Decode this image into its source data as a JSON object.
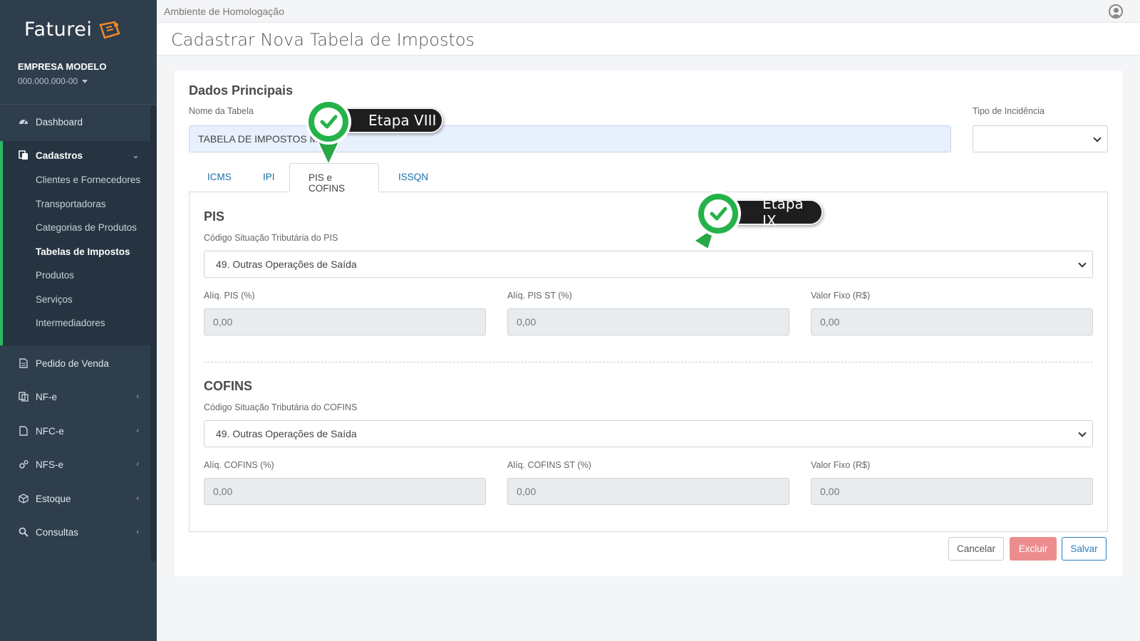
{
  "brand": {
    "name": "Faturei"
  },
  "company": {
    "name": "EMPRESA MODELO",
    "document": "000.000.000-00"
  },
  "sidebar": {
    "items": [
      {
        "label": "Dashboard",
        "icon": "dashboard-icon"
      },
      {
        "label": "Cadastros",
        "icon": "copy-icon",
        "expanded": true
      },
      {
        "label": "Pedido de Venda",
        "icon": "file-icon"
      },
      {
        "label": "NF-e",
        "icon": "copy-icon"
      },
      {
        "label": "NFC-e",
        "icon": "file-icon"
      },
      {
        "label": "NFS-e",
        "icon": "cogs-icon"
      },
      {
        "label": "Estoque",
        "icon": "cube-icon"
      },
      {
        "label": "Consultas",
        "icon": "search-icon"
      }
    ],
    "submenu": [
      {
        "label": "Clientes e Fornecedores"
      },
      {
        "label": "Transportadoras"
      },
      {
        "label": "Categorias de Produtos"
      },
      {
        "label": "Tabelas de Impostos",
        "active": true
      },
      {
        "label": "Produtos"
      },
      {
        "label": "Serviços"
      },
      {
        "label": "Intermediadores"
      }
    ]
  },
  "topbar": {
    "environment": "Ambiente de Homologação"
  },
  "page": {
    "title": "Cadastrar Nova Tabela de Impostos"
  },
  "main": {
    "section_title": "Dados Principais",
    "table_name_label": "Nome da Tabela",
    "table_name_value": "TABELA DE IMPOSTOS M",
    "incidence_label": "Tipo de Incidência",
    "incidence_value": "",
    "tabs": [
      {
        "label": "ICMS"
      },
      {
        "label": "IPI"
      },
      {
        "label": "PIS e COFINS",
        "active": true
      },
      {
        "label": "ISSQN"
      }
    ],
    "pis": {
      "title": "PIS",
      "cst_label": "Código Situação Tributária do PIS",
      "cst_value": "49. Outras Operações de Saída",
      "rate_label": "Alíq. PIS (%)",
      "rate_value": "0,00",
      "st_rate_label": "Alíq. PIS ST (%)",
      "st_rate_value": "0,00",
      "fixed_label": "Valor Fixo (R$)",
      "fixed_value": "0,00"
    },
    "cofins": {
      "title": "COFINS",
      "cst_label": "Código Situação Tributária do COFINS",
      "cst_value": "49. Outras Operações de Saída",
      "rate_label": "Alíq. COFINS (%)",
      "rate_value": "0,00",
      "st_rate_label": "Alíq. COFINS ST (%)",
      "st_rate_value": "0,00",
      "fixed_label": "Valor Fixo (R$)",
      "fixed_value": "0,00"
    },
    "buttons": {
      "cancel": "Cancelar",
      "delete": "Excluir",
      "save": "Salvar"
    }
  },
  "steps": [
    {
      "label": "Etapa VIII"
    },
    {
      "label": "Etapa IX"
    }
  ],
  "colors": {
    "sidebar_bg": "#2f3e4c",
    "accent_green": "#27b864",
    "link_blue": "#1a6fa8",
    "delete_red": "#ec8d8d",
    "save_blue": "#2d7fc1"
  }
}
